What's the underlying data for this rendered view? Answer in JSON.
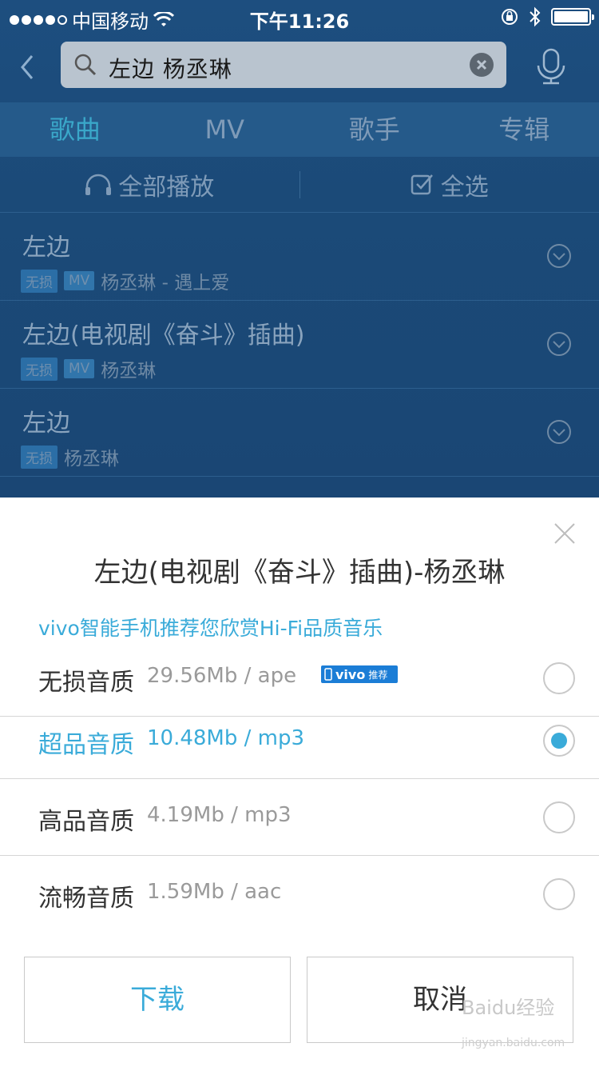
{
  "status_bar": {
    "carrier": "中国移动",
    "time": "下午11:26"
  },
  "search": {
    "query": "左边   杨丞琳"
  },
  "tabs": [
    {
      "label": "歌曲",
      "active": true
    },
    {
      "label": "MV",
      "active": false
    },
    {
      "label": "歌手",
      "active": false
    },
    {
      "label": "专辑",
      "active": false
    }
  ],
  "actions": {
    "play_all": "全部播放",
    "select_all": "全选"
  },
  "songs": [
    {
      "title": "左边",
      "badges": [
        "无损",
        "MV"
      ],
      "artist": "杨丞琳 - 遇上爱"
    },
    {
      "title": "左边(电视剧《奋斗》插曲)",
      "badges": [
        "无损",
        "MV"
      ],
      "artist": "杨丞琳"
    },
    {
      "title": "左边",
      "badges": [
        "无损"
      ],
      "artist": "杨丞琳"
    }
  ],
  "sheet": {
    "title": "左边(电视剧《奋斗》插曲)-杨丞琳",
    "promo": "vivo智能手机推荐您欣赏Hi-Fi品质音乐",
    "vivo_badge": {
      "brand": "vivo",
      "text": "推荐"
    },
    "options": [
      {
        "label": "无损音质",
        "size": "29.56Mb / ape",
        "selected": false
      },
      {
        "label": "超品音质",
        "size": "10.48Mb / mp3",
        "selected": true
      },
      {
        "label": "高品音质",
        "size": "4.19Mb / mp3",
        "selected": false
      },
      {
        "label": "流畅音质",
        "size": "1.59Mb / aac",
        "selected": false
      }
    ],
    "download_label": "下载",
    "cancel_label": "取消"
  },
  "watermark": {
    "main": "Baidu经验",
    "sub": "jingyan.baidu.com"
  },
  "colors": {
    "accent": "#3aabd9",
    "header_bg": "#1d4e7f",
    "text": "#333333"
  }
}
